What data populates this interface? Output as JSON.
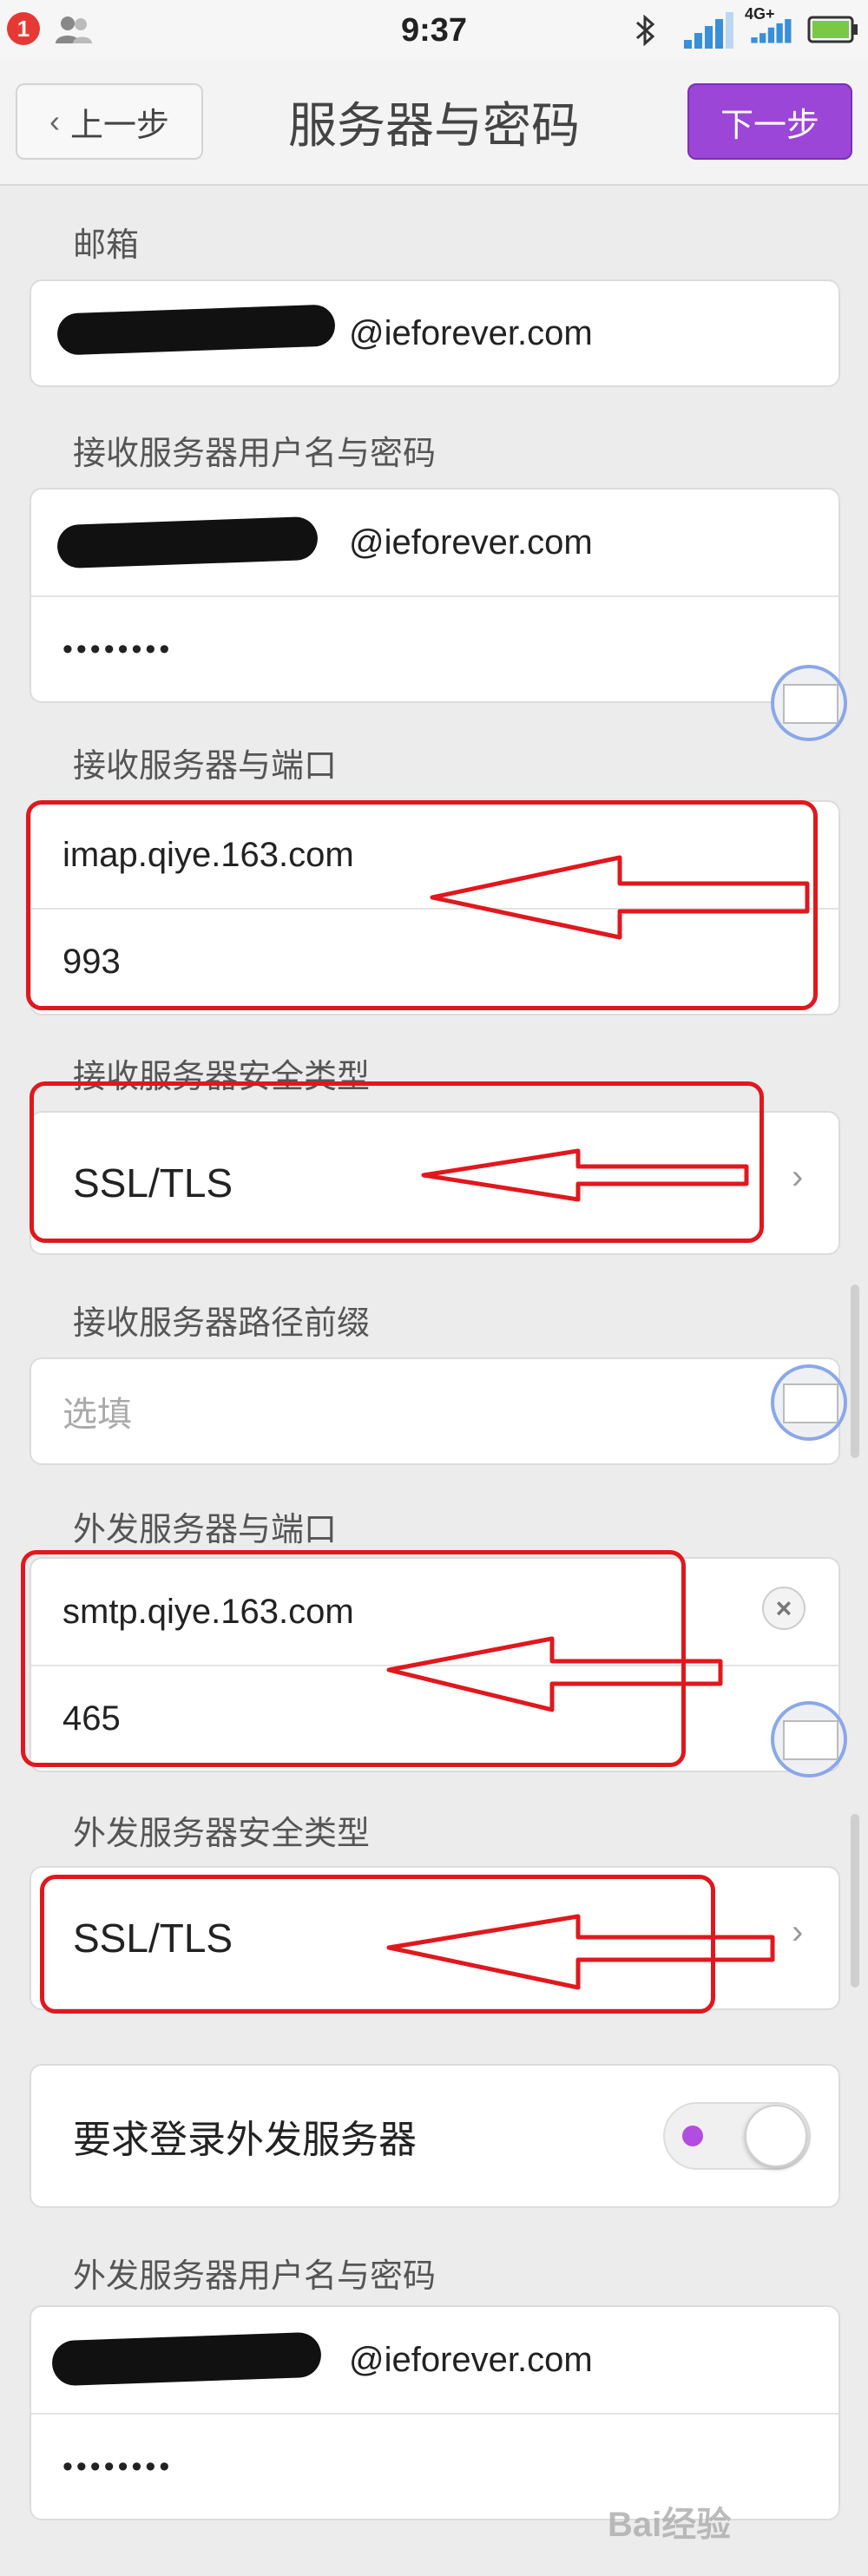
{
  "status_bar": {
    "notification_count": "1",
    "time": "9:37",
    "network_label": "4G+"
  },
  "nav": {
    "back_label": "上一步",
    "title": "服务器与密码",
    "next_label": "下一步",
    "accent": "#9b46d6"
  },
  "email": {
    "label": "邮箱",
    "value": "@ieforever.com"
  },
  "incoming_credentials": {
    "label": "接收服务器用户名与密码",
    "username": "@ieforever.com",
    "password": "••••••••"
  },
  "incoming_server": {
    "label": "接收服务器与端口",
    "host": "imap.qiye.163.com",
    "port": "993"
  },
  "incoming_security": {
    "label": "接收服务器安全类型",
    "value": "SSL/TLS"
  },
  "incoming_path_prefix": {
    "label": "接收服务器路径前缀",
    "placeholder": "选填"
  },
  "outgoing_server": {
    "label": "外发服务器与端口",
    "host": "smtp.qiye.163.com",
    "port": "465"
  },
  "outgoing_security": {
    "label": "外发服务器安全类型",
    "value": "SSL/TLS"
  },
  "require_login": {
    "label": "要求登录外发服务器",
    "enabled": true
  },
  "outgoing_credentials": {
    "label": "外发服务器用户名与密码",
    "username": "@ieforever.com",
    "password": "••••••••"
  },
  "watermark": {
    "text": "Bai经验"
  },
  "annotation_color": "#e0181e"
}
